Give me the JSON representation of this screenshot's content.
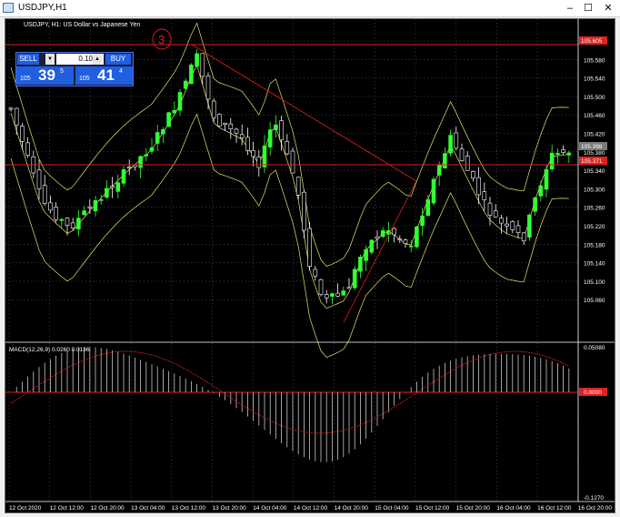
{
  "window": {
    "title": "USDJPY,H1",
    "minimize": "–",
    "maximize": "☐",
    "close": "✕"
  },
  "chart": {
    "symbol_label": "USDJPY, H1:  US Dollar vs Japanese Yen",
    "annotation": "3",
    "price_axis": [
      "105.620",
      "105.580",
      "105.540",
      "105.500",
      "105.460",
      "105.420",
      "105.380",
      "105.340",
      "105.300",
      "105.260",
      "105.220",
      "105.180",
      "105.140",
      "105.100",
      "105.060"
    ],
    "bid_label": "105.398",
    "line_label_top": "105.605",
    "line_label_mid": "105.371",
    "macd": {
      "label": "MACD(12,26,9) 0.0260 0.0136",
      "axis_top": "0.05080",
      "axis_zero": "0.0000",
      "axis_bottom": "-0.1270"
    },
    "time_axis": [
      "12 Oct 2020",
      "12 Oct 12:00",
      "12 Oct 20:00",
      "13 Oct 04:00",
      "13 Oct 12:00",
      "13 Oct 20:00",
      "14 Oct 04:00",
      "14 Oct 12:00",
      "14 Oct 20:00",
      "15 Oct 04:00",
      "15 Oct 12:00",
      "15 Oct 20:00",
      "16 Oct 04:00",
      "16 Oct 12:00",
      "16 Oct 20:00"
    ]
  },
  "trade_panel": {
    "sell": "SELL",
    "buy": "BUY",
    "volume": "0.10",
    "sell_prefix": "105",
    "sell_big": "39",
    "sell_sup": "5",
    "buy_prefix": "105",
    "buy_big": "41",
    "buy_sup": "4"
  },
  "colors": {
    "bull": "#33ff33",
    "bear": "#ffffff",
    "bands": "#e6e66a",
    "line": "#e02020",
    "macd": "#c8c8c8",
    "signal": "#e02020",
    "grid": "#5a5a5a"
  }
}
